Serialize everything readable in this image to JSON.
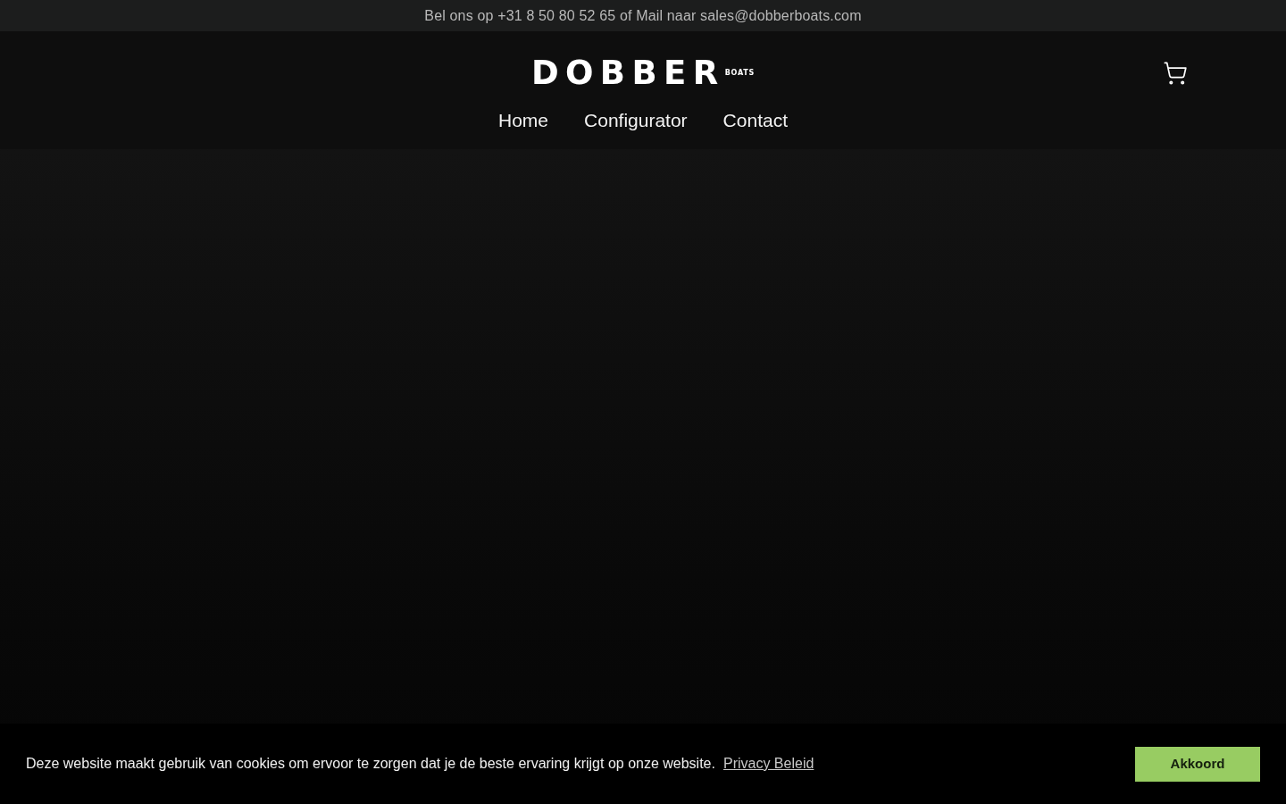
{
  "announcement": {
    "text": "Bel ons op +31 8 50 80 52 65 of Mail naar sales@dobberboats.com"
  },
  "header": {
    "logo": {
      "wordmark": "DOBBER",
      "subtitle": "BOATS"
    },
    "nav": [
      {
        "label": "Home"
      },
      {
        "label": "Configurator"
      },
      {
        "label": "Contact"
      }
    ]
  },
  "cookie_banner": {
    "message": "Deze website maakt gebruik van cookies om ervoor te zorgen dat je de beste ervaring krijgt op onze website.",
    "link": "Privacy Beleid",
    "button": "Akkoord"
  }
}
